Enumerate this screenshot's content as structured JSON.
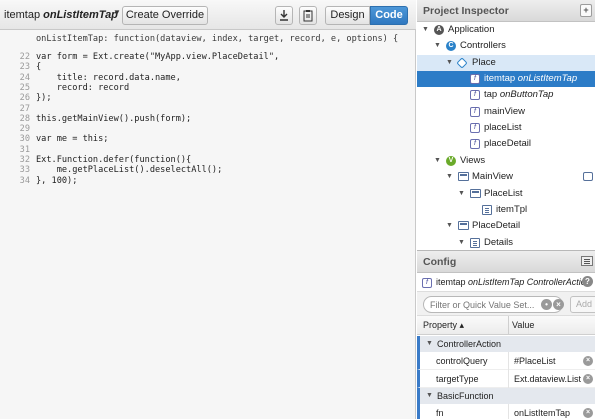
{
  "toolbar": {
    "title_prefix": "itemtap",
    "title_event": "onListItemTap",
    "dropdown_glyph": "▼",
    "create_override_label": "Create Override",
    "download_icon": "download-icon",
    "clipboard_icon": "clipboard-icon",
    "design_label": "Design",
    "code_label": "Code",
    "active_mode": "Code",
    "accent_color": "#2f78c0"
  },
  "code": {
    "signature": "onListItemTap: function(dataview, index, target, record, e, options) {",
    "lines": [
      {
        "num": "22",
        "text": "var form = Ext.create(\"MyApp.view.PlaceDetail\","
      },
      {
        "num": "23",
        "text": "{"
      },
      {
        "num": "24",
        "text": "    title: record.data.name,"
      },
      {
        "num": "25",
        "text": "    record: record"
      },
      {
        "num": "26",
        "text": "});"
      },
      {
        "num": "27",
        "text": ""
      },
      {
        "num": "28",
        "text": "this.getMainView().push(form);"
      },
      {
        "num": "29",
        "text": ""
      },
      {
        "num": "30",
        "text": "var me = this;"
      },
      {
        "num": "31",
        "text": ""
      },
      {
        "num": "32",
        "text": "Ext.Function.defer(function(){"
      },
      {
        "num": "33",
        "text": "    me.getPlaceList().deselectAll();"
      },
      {
        "num": "34",
        "text": "}, 100);"
      }
    ]
  },
  "inspector": {
    "title": "Project Inspector",
    "header_button": "+",
    "tree": [
      {
        "label": "Application",
        "italic": "",
        "icon": "application-icon",
        "state": "none"
      },
      {
        "label": "Controllers",
        "italic": "",
        "icon": "controller-icon",
        "state": "none"
      },
      {
        "label": "Place",
        "italic": "",
        "icon": "place-controller-icon",
        "state": "light"
      },
      {
        "label": "itemtap",
        "italic": "onListItemTap",
        "icon": "function-icon",
        "state": "dark"
      },
      {
        "label": "tap",
        "italic": "onButtonTap",
        "icon": "function-icon",
        "state": "none"
      },
      {
        "label": "mainView",
        "italic": "",
        "icon": "function-icon",
        "state": "none"
      },
      {
        "label": "placeList",
        "italic": "",
        "icon": "function-icon",
        "state": "none"
      },
      {
        "label": "placeDetail",
        "italic": "",
        "icon": "function-icon",
        "state": "none"
      },
      {
        "label": "Views",
        "italic": "",
        "icon": "views-icon",
        "state": "none"
      },
      {
        "label": "MainView",
        "italic": "",
        "icon": "view-icon",
        "state": "none"
      },
      {
        "label": "PlaceList",
        "italic": "",
        "icon": "view-icon",
        "state": "none"
      },
      {
        "label": "itemTpl",
        "italic": "",
        "icon": "template-icon",
        "state": "none"
      },
      {
        "label": "PlaceDetail",
        "italic": "",
        "icon": "view-icon",
        "state": "none"
      },
      {
        "label": "Details",
        "italic": "",
        "icon": "template-icon",
        "state": "none"
      }
    ],
    "selection_color": "#2c7cc7"
  },
  "config": {
    "title": "Config",
    "subtitle_prefix": "itemtap",
    "subtitle_event": "onListItemTap",
    "subtitle_type": "ControllerAction",
    "help_glyph": "?",
    "filter_placeholder": "Filter or Quick Value Set...",
    "add_label": "Add",
    "col_property": "Property ▴",
    "col_value": "Value",
    "groups": [
      {
        "name": "ControllerAction",
        "props": [
          {
            "name": "controlQuery",
            "value": "#PlaceList"
          },
          {
            "name": "targetType",
            "value": "Ext.dataview.List"
          }
        ]
      },
      {
        "name": "BasicFunction",
        "props": [
          {
            "name": "fn",
            "value": "onListItemTap"
          }
        ]
      }
    ]
  }
}
